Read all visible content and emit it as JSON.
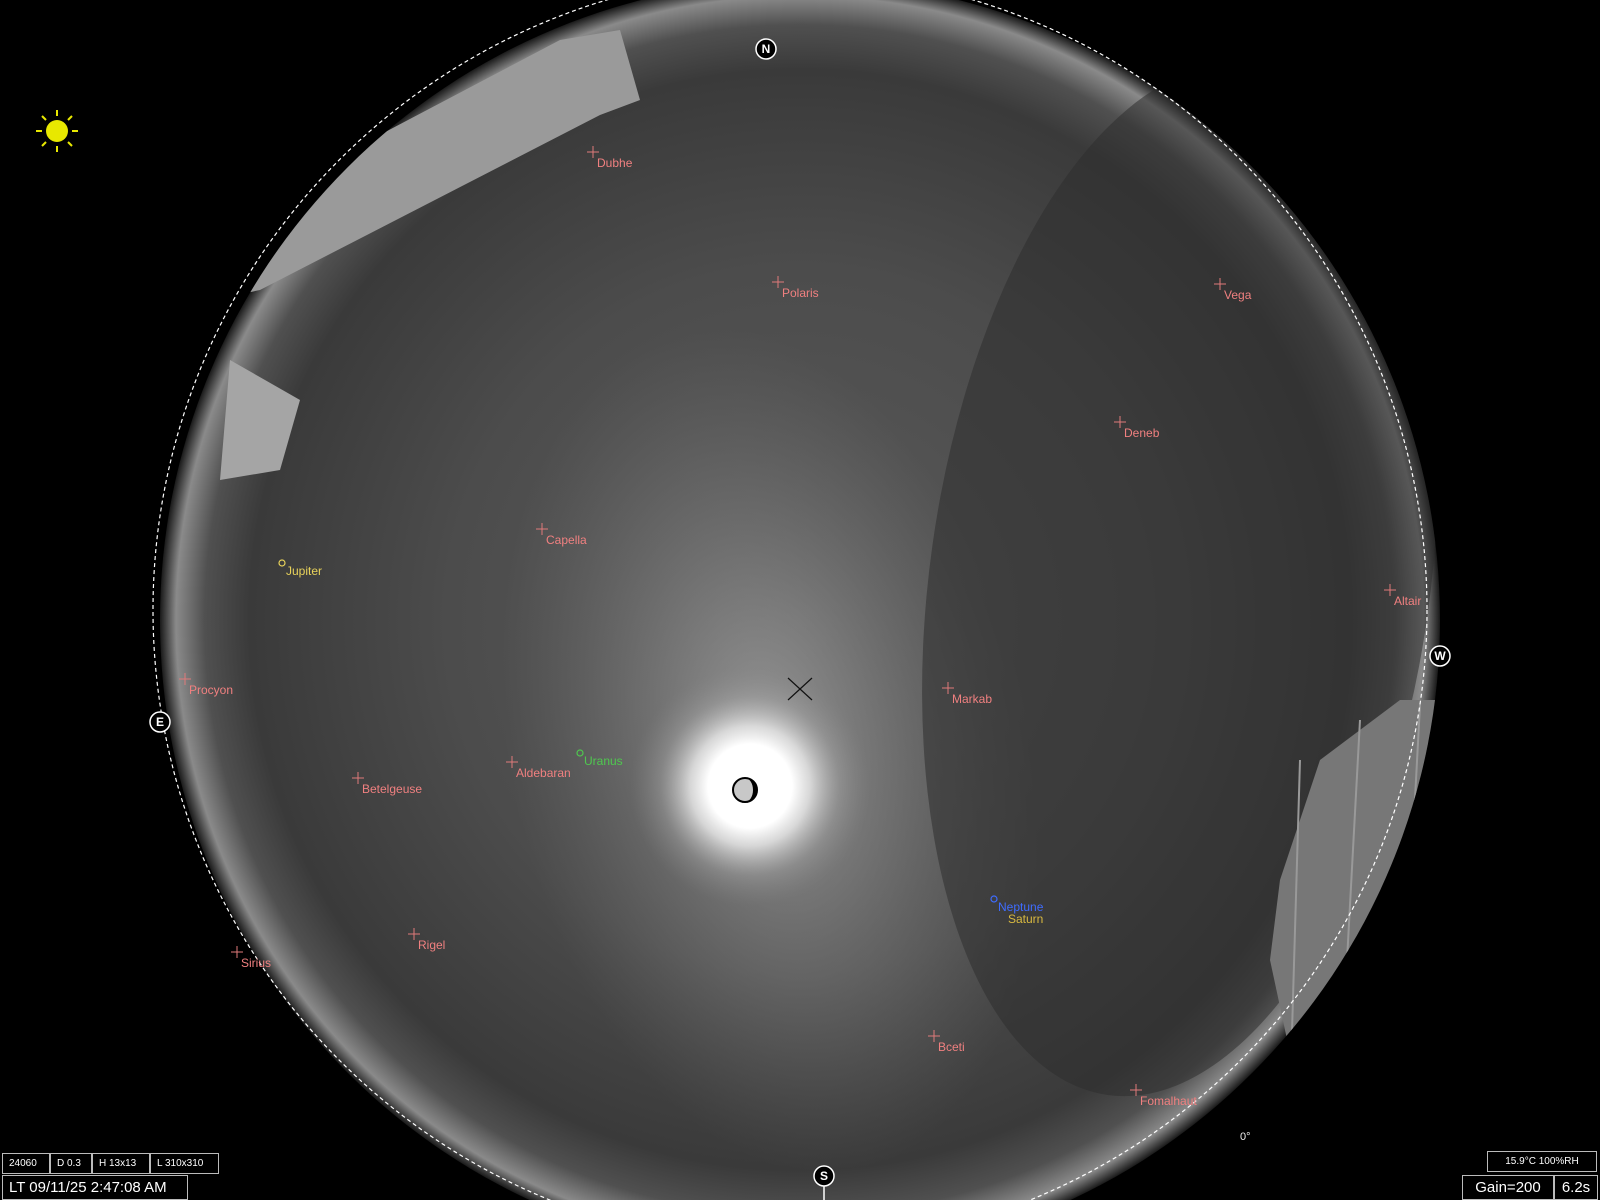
{
  "cardinals": [
    {
      "id": "north",
      "label": "N"
    },
    {
      "id": "east",
      "label": "E"
    },
    {
      "id": "south",
      "label": "S"
    },
    {
      "id": "west",
      "label": "W"
    }
  ],
  "stars": [
    {
      "name": "Dubhe"
    },
    {
      "name": "Polaris"
    },
    {
      "name": "Vega"
    },
    {
      "name": "Deneb"
    },
    {
      "name": "Capella"
    },
    {
      "name": "Altair"
    },
    {
      "name": "Procyon"
    },
    {
      "name": "Markab"
    },
    {
      "name": "Aldebaran"
    },
    {
      "name": "Betelgeuse"
    },
    {
      "name": "Rigel"
    },
    {
      "name": "Sirius"
    },
    {
      "name": "Bceti"
    },
    {
      "name": "Fomalhaut"
    }
  ],
  "planets": [
    {
      "name": "Jupiter",
      "color": "#e8d25a"
    },
    {
      "name": "Uranus",
      "color": "#4fc84f"
    },
    {
      "name": "Neptune",
      "color": "#3f6cff"
    },
    {
      "name": "Saturn",
      "color": "#d8b940"
    }
  ],
  "horizon_marker": "0°",
  "status": {
    "frame_id": "24060",
    "d_value": "D 0.3",
    "h_value": "H 13x13",
    "l_value": "L 310x310",
    "local_time": "LT 09/11/25 2:47:08 AM",
    "weather": "15.9°C 100%RH",
    "gain": "Gain=200",
    "exposure": "6.2s"
  }
}
